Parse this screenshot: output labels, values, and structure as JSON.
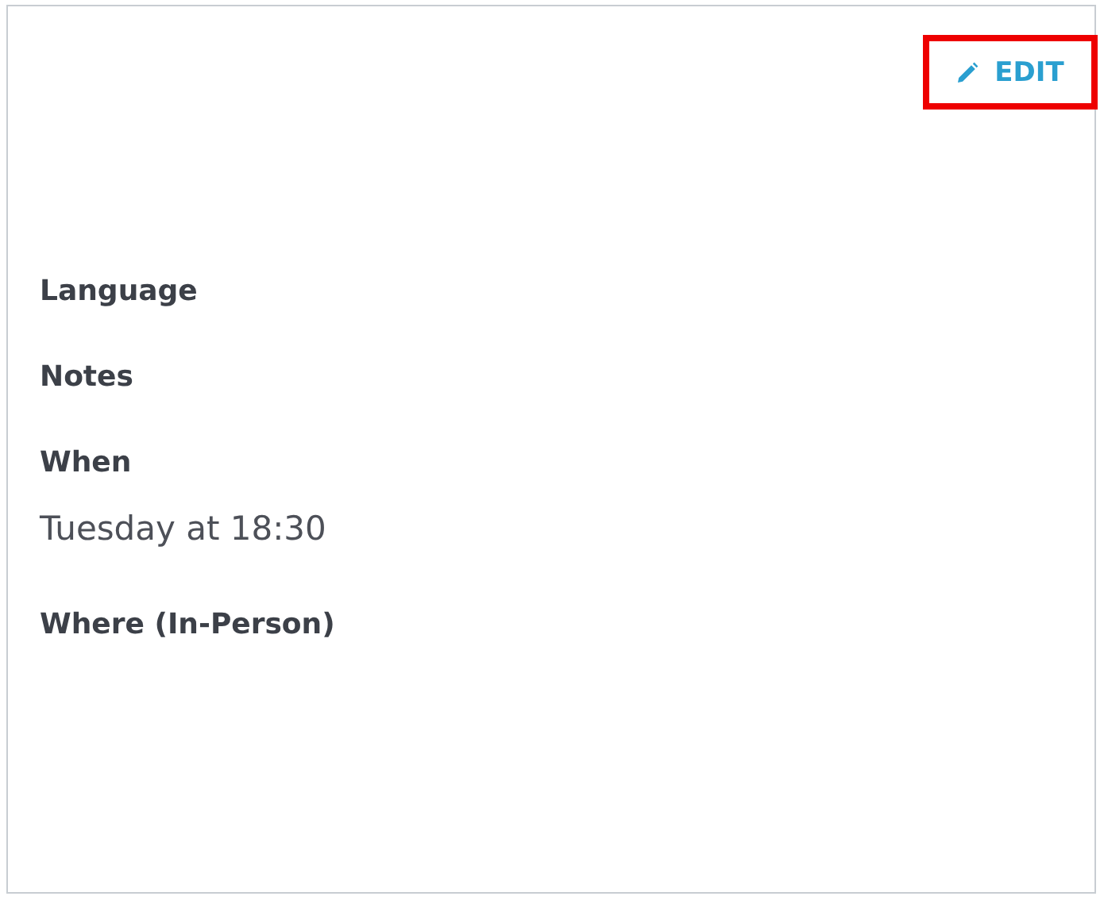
{
  "edit_button": {
    "label": "EDIT",
    "highlighted": true
  },
  "fields": [
    {
      "label": "Language"
    },
    {
      "label": "Notes"
    },
    {
      "label": "When",
      "value": "Tuesday at 18:30"
    },
    {
      "label": "Where (In-Person)"
    }
  ]
}
